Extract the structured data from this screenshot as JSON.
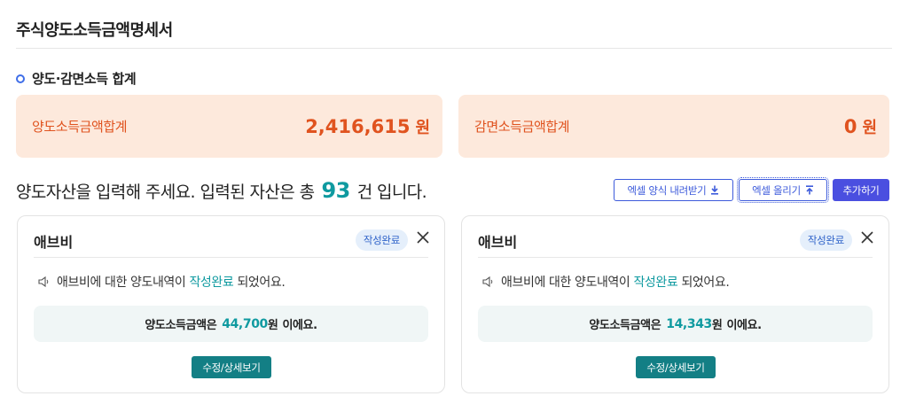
{
  "page": {
    "title": "주식양도소득금액명세서"
  },
  "summary": {
    "section_title": "양도·감면소득 합계",
    "transfer_income": {
      "label": "양도소득금액합계",
      "value": "2,416,615",
      "unit": "원"
    },
    "reduction_income": {
      "label": "감면소득금액합계",
      "value": "0",
      "unit": "원"
    }
  },
  "assets": {
    "prompt_before": "양도자산을 입력해 주세요. 입력된 자산은 총",
    "count": "93",
    "prompt_after": "건 입니다.",
    "download_label": "엑셀 양식 내려받기",
    "upload_label": "엑셀 올리기",
    "add_label": "추가하기",
    "cards": [
      {
        "name": "애브비",
        "status": "작성완료",
        "notice_prefix": "애브비에 대한 양도내역이",
        "notice_highlight": "작성완료",
        "notice_suffix": "되었어요.",
        "amount_prefix": "양도소득금액은",
        "amount": "44,700",
        "amount_unit": "원",
        "amount_suffix": "이에요.",
        "detail_label": "수정/상세보기"
      },
      {
        "name": "애브비",
        "status": "작성완료",
        "notice_prefix": "애브비에 대한 양도내역이",
        "notice_highlight": "작성완료",
        "notice_suffix": "되었어요.",
        "amount_prefix": "양도소득금액은",
        "amount": "14,343",
        "amount_unit": "원",
        "amount_suffix": "이에요.",
        "detail_label": "수정/상세보기"
      }
    ]
  },
  "colors": {
    "accent": "#0f9aa0",
    "primary_button": "#4a4fe0",
    "summary_card_bg": "#fde9dc",
    "summary_text": "#e0531f"
  }
}
